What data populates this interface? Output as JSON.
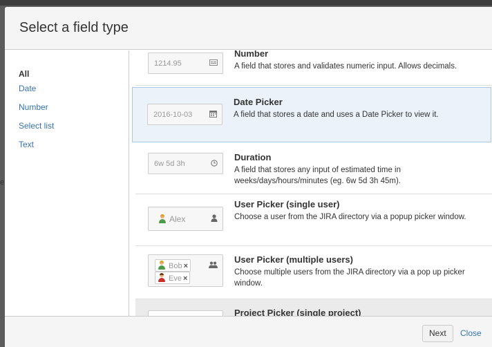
{
  "dialog": {
    "title": "Select a field type"
  },
  "sidebar": {
    "items": [
      {
        "label": "All",
        "selected": true
      },
      {
        "label": "Date",
        "selected": false
      },
      {
        "label": "Number",
        "selected": false
      },
      {
        "label": "Select list",
        "selected": false
      },
      {
        "label": "Text",
        "selected": false
      }
    ]
  },
  "field_types": [
    {
      "title": "Number",
      "description": "A field that stores and validates numeric input. Allows decimals.",
      "preview_value": "1214.95",
      "preview_icon": "number-field-icon",
      "state": "normal"
    },
    {
      "title": "Date Picker",
      "description": "A field that stores a date and uses a Date Picker to view it.",
      "preview_value": "2016-10-03",
      "preview_icon": "calendar-icon",
      "state": "selected"
    },
    {
      "title": "Duration",
      "description": "A field that stores any input of estimated time in weeks/days/hours/minutes (eg. 6w 5d 3h 45m).",
      "preview_value": "6w 5d 3h",
      "preview_icon": "clock-icon",
      "state": "normal"
    },
    {
      "title": "User Picker (single user)",
      "description": "Choose a user from the JIRA directory via a popup picker window.",
      "preview_value": "Alex",
      "preview_icon": "user-icon",
      "state": "normal"
    },
    {
      "title": "User Picker (multiple users)",
      "description": "Choose multiple users from the JIRA directory via a pop up picker window.",
      "preview_values": [
        "Bob",
        "Eve"
      ],
      "remove_glyph": "×",
      "preview_icon": "users-icon",
      "state": "normal"
    },
    {
      "title": "Project Picker (single project)",
      "description": "",
      "state": "hover"
    }
  ],
  "footer": {
    "next_label": "Next",
    "close_label": "Close"
  },
  "colors": {
    "link": "#3572b0",
    "selected_bg": "#ebf2f9",
    "selected_border": "#a9c6e3",
    "hover_bg": "#ebebeb",
    "header_bg": "#f5f5f5"
  }
}
